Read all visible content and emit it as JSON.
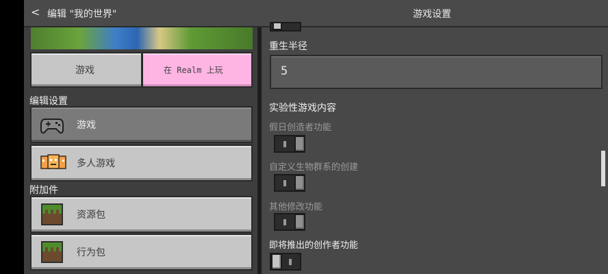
{
  "header": {
    "back_glyph": "<",
    "edit_title": "编辑 \"我的世界\"",
    "settings_title": "游戏设置"
  },
  "left": {
    "play_button": "游戏",
    "realm_button": "在 Realm 上玩",
    "edit_settings_label": "编辑设置",
    "items": [
      {
        "label": "游戏",
        "icon": "controller-icon",
        "selected": true
      },
      {
        "label": "多人游戏",
        "icon": "multiplayer-icon",
        "selected": false
      }
    ],
    "addons_label": "附加件",
    "addons": [
      {
        "label": "资源包",
        "icon": "grass-block-icon"
      },
      {
        "label": "行为包",
        "icon": "grass-block-icon"
      }
    ]
  },
  "right": {
    "respawn_label": "重生半径",
    "respawn_value": "5",
    "experimental_title": "实验性游戏内容",
    "options": [
      {
        "label": "假日创造者功能",
        "enabled": false,
        "state": "off"
      },
      {
        "label": "自定义生物群系的创建",
        "enabled": false,
        "state": "off"
      },
      {
        "label": "其他修改功能",
        "enabled": false,
        "state": "off"
      },
      {
        "label": "即将推出的创作者功能",
        "enabled": true,
        "state": "off"
      }
    ]
  },
  "colors": {
    "realm_pink": "#ffb5e4",
    "button_gray": "#c6c6c6",
    "selected_gray": "#7a7a7a"
  }
}
